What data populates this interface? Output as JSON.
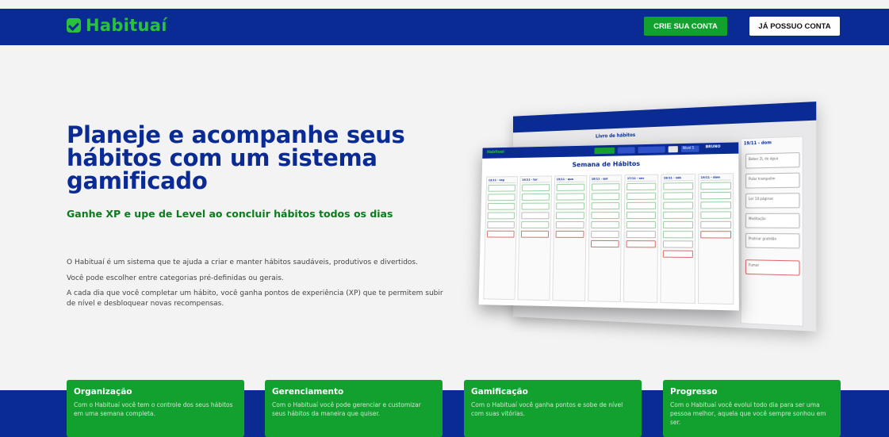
{
  "header": {
    "logo_text": "Habituaí",
    "logo_icon": "check-square-icon",
    "create_account": "CRIE SUA CONTA",
    "have_account": "JÁ POSSUO CONTA"
  },
  "hero": {
    "title": "Planeje e acompanhe seus hábitos com um sistema gamificado",
    "subtitle": "Ganhe XP e upe de Level ao concluir hábitos todos os dias",
    "paragraph_1": "O Habituaí é um sistema que te ajuda a criar e manter hábitos saudáveis, produtivos e divertidos.",
    "paragraph_2": "Você pode escolher entre categorias pré-definidas ou gerais.",
    "paragraph_3": "A cada dia que você completar um hábito, você ganha pontos de experiência (XP) que te permitem subir de nível e desbloquear novas recompensas."
  },
  "mockup": {
    "heading": "Semana de Hábitos",
    "back_heading": "Livro de hábitos",
    "user_label": "BRUNO",
    "level_label": "Nível 5",
    "back_day_header": "19/11 - dom",
    "back_items": [
      "Beber 2L de água",
      "Pular trampolim",
      "Ler 10 páginas",
      "Meditação",
      "Praticar gratidão",
      "Fumar"
    ],
    "days": [
      "13/11 - seg",
      "14/11 - ter",
      "15/11 - qua",
      "16/11 - qui",
      "17/11 - sex",
      "18/11 - sáb",
      "19/11 - dom"
    ]
  },
  "features": [
    {
      "title": "Organização",
      "text": "Com o Habituaí você tem o controle dos seus hábitos em uma semana completa."
    },
    {
      "title": "Gerenciamento",
      "text": "Com o Habituaí você pode gerenciar e customizar seus hábitos da maneira que quiser."
    },
    {
      "title": "Gamificação",
      "text": "Com o Habituaí você ganha pontos e sobe de nível com suas vitórias."
    },
    {
      "title": "Progresso",
      "text": "Com o Habituaí você evolui todo dia para ser uma pessoa melhor, aquela que você sempre sonhou em ser."
    }
  ],
  "colors": {
    "primary_blue": "#0a2b94",
    "brand_green": "#29c23a",
    "button_green": "#12a12f",
    "subtitle_green": "#0d7a1f"
  }
}
